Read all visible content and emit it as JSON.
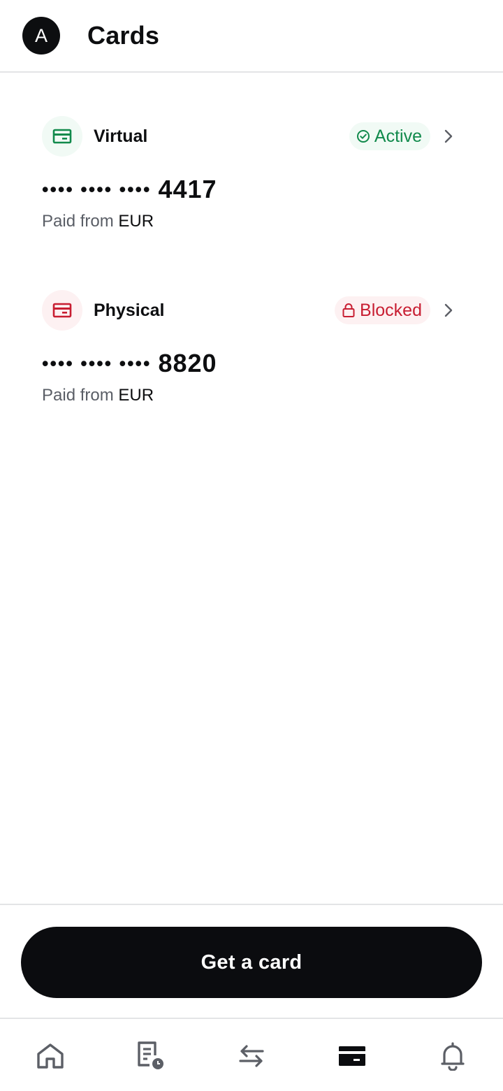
{
  "header": {
    "avatar_initial": "A",
    "title": "Cards"
  },
  "cards": [
    {
      "type_label": "Virtual",
      "status": "Active",
      "masked": "•••• •••• ••••",
      "last4": "4417",
      "funding_prefix": "Paid from",
      "funding_currency": "EUR",
      "accent_color": "#118a4c",
      "icon": "card-icon"
    },
    {
      "type_label": "Physical",
      "status": "Blocked",
      "masked": "•••• •••• ••••",
      "last4": "8820",
      "funding_prefix": "Paid from",
      "funding_currency": "EUR",
      "accent_color": "#c81e32",
      "icon": "card-icon"
    }
  ],
  "actions": {
    "get_card_label": "Get a card"
  },
  "bottom_nav": {
    "items": [
      {
        "icon": "home-icon",
        "active": false
      },
      {
        "icon": "transactions-history-icon",
        "active": false
      },
      {
        "icon": "transfer-arrows-icon",
        "active": false
      },
      {
        "icon": "card-icon",
        "active": true
      },
      {
        "icon": "bell-icon",
        "active": false
      }
    ]
  },
  "colors": {
    "primary": "#0b0c0f",
    "active_status": "#118a4c",
    "blocked_status": "#c81e32",
    "muted_text": "#5a5e66",
    "nav_icon": "#5c5f66"
  }
}
